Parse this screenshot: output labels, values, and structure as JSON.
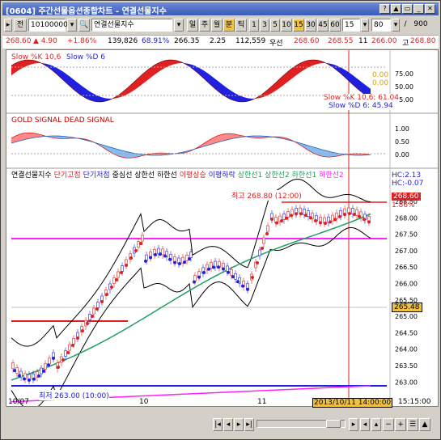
{
  "window": {
    "title": "[0604] 주간선물옵션종합차트 - 연결선물지수"
  },
  "toolbar": {
    "code_label": "전",
    "code_value": "10100000",
    "name_value": "연결선물지수",
    "period_buttons": [
      "일",
      "주",
      "월",
      "분",
      "틱"
    ],
    "minute_buttons": [
      "1",
      "3",
      "5",
      "10",
      "15",
      "30",
      "45",
      "60"
    ],
    "selected_minute": "15",
    "count_value": "80",
    "page_value": "900"
  },
  "quote": {
    "price": "268.60",
    "change": "▲ 4.90",
    "pct": "+1.86%",
    "volume": "139,826",
    "ratio": "68.91%",
    "open_label": "266.35",
    "v2": "2.25",
    "v3": "112,559",
    "u_label": "우선",
    "v4": "268.60",
    "v5": "268.55",
    "v6": "11",
    "v7": "266.00",
    "hi_label": "고",
    "hi_value": "268.80"
  },
  "panel_slow": {
    "title_k": "Slow %K 10,6",
    "title_d": "Slow %D 6",
    "readout_k": "Slow %K 10,6: 61.04",
    "readout_d": "Slow %D 6: 45.94",
    "ticks": [
      "75.00",
      "50.00",
      "25.00"
    ],
    "top_tag": "0.00"
  },
  "panel_macd": {
    "title": "GOLD SIGNAL DEAD SIGNAL",
    "ticks": [
      "1.00",
      "0.50",
      "0.00"
    ]
  },
  "panel_price": {
    "legend": [
      "연결선물지수",
      "단기고점",
      "단기저점",
      "중심선",
      "상한선",
      "하한선",
      "이평상승",
      "이평하락",
      "상한선1",
      "상한선2",
      "하한선1",
      "하한선2"
    ],
    "hc_label": "HC:2.13",
    "hc2_label": "HC:-0.07",
    "high_note": "최고 268.80 (12:00)",
    "low_note": "최저 263.00 (10:00)",
    "current_price_tag": "268.60",
    "current_pct_tag": "1.86%",
    "ref_price_tag": "265.48",
    "ticks": [
      "268.50",
      "268.00",
      "267.50",
      "267.00",
      "266.50",
      "266.00",
      "265.50",
      "265.00",
      "264.50",
      "264.00",
      "263.50",
      "263.00"
    ]
  },
  "xaxis": {
    "labels": [
      "10/07",
      "10",
      "11"
    ],
    "cursor_label": "2013/10/11 14:00:00",
    "time_label": "15:15:00"
  },
  "colors": {
    "up": "#e02020",
    "down": "#2020e0",
    "green": "#20a060",
    "magenta": "#ff20ff",
    "accent": "#f0c040"
  }
}
